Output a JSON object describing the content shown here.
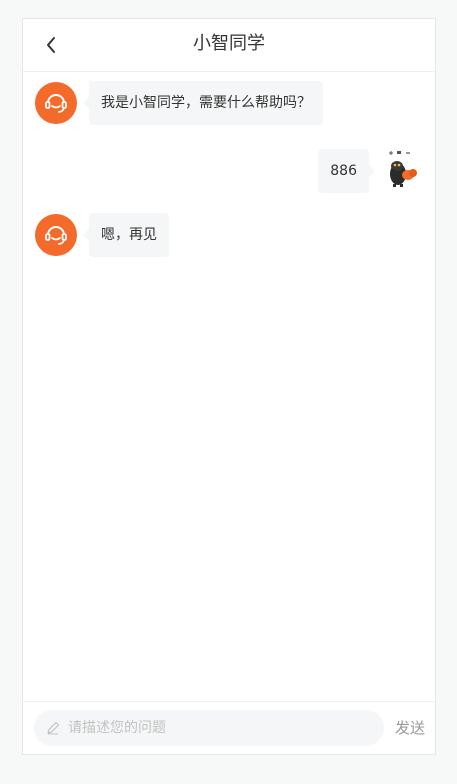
{
  "header": {
    "title": "小智同学",
    "back_icon": "chevron-left-icon"
  },
  "messages": [
    {
      "from": "bot",
      "avatar_icon": "headset-icon",
      "text": "我是小智同学，需要什么帮助吗？"
    },
    {
      "from": "user",
      "avatar_icon": "sticker-avatar",
      "text": "886"
    },
    {
      "from": "bot",
      "avatar_icon": "headset-icon",
      "text": "嗯，再见"
    }
  ],
  "footer": {
    "input_icon": "pencil-icon",
    "input_placeholder": "请描述您的问题",
    "send_label": "发送"
  },
  "colors": {
    "accent": "#f46a2a",
    "bubble": "#f5f6f7",
    "text": "#333333",
    "muted": "#999999"
  }
}
